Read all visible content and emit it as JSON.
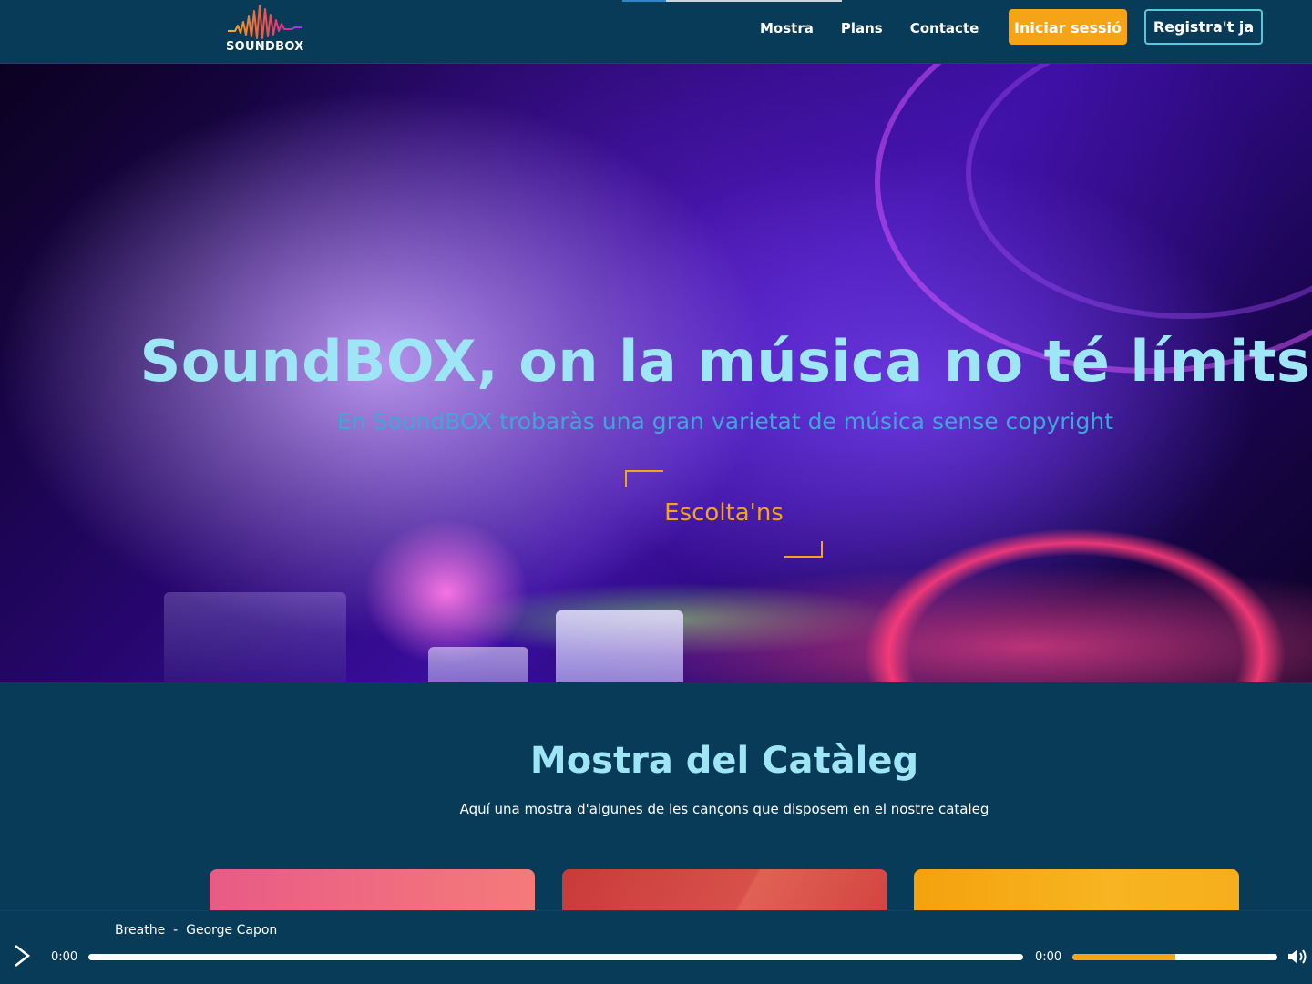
{
  "brand": {
    "name": "SOUNDBOX",
    "colors": {
      "primary_bg": "#073b58",
      "accent_orange": "#f4a416",
      "accent_cyan": "#9ee6f5",
      "register_border": "#59c7d8"
    }
  },
  "nav": {
    "links": [
      "Mostra",
      "Plans",
      "Contacte"
    ],
    "login_label": "Iniciar sessió",
    "register_label": "Registra't ja"
  },
  "hero": {
    "title": "SoundBOX, on la música no té límits",
    "subtitle": "En SoundBOX trobaràs una gran varietat de música sense copyright",
    "cta_label": "Escolta'ns"
  },
  "catalog": {
    "title": "Mostra del Catàleg",
    "description": "Aquí una mostra d'algunes de les cançons que disposem en el nostre cataleg",
    "cards": [
      {
        "color": "#e85b86"
      },
      {
        "color": "#d3433f"
      },
      {
        "color": "#f3a20d"
      }
    ]
  },
  "player": {
    "track_title": "Breathe",
    "separator": "-",
    "artist": "George Capon",
    "current_time": "0:00",
    "duration": "0:00",
    "progress": 0,
    "volume": 0.5,
    "icons": {
      "play": "play-icon",
      "volume": "volume-icon"
    }
  }
}
